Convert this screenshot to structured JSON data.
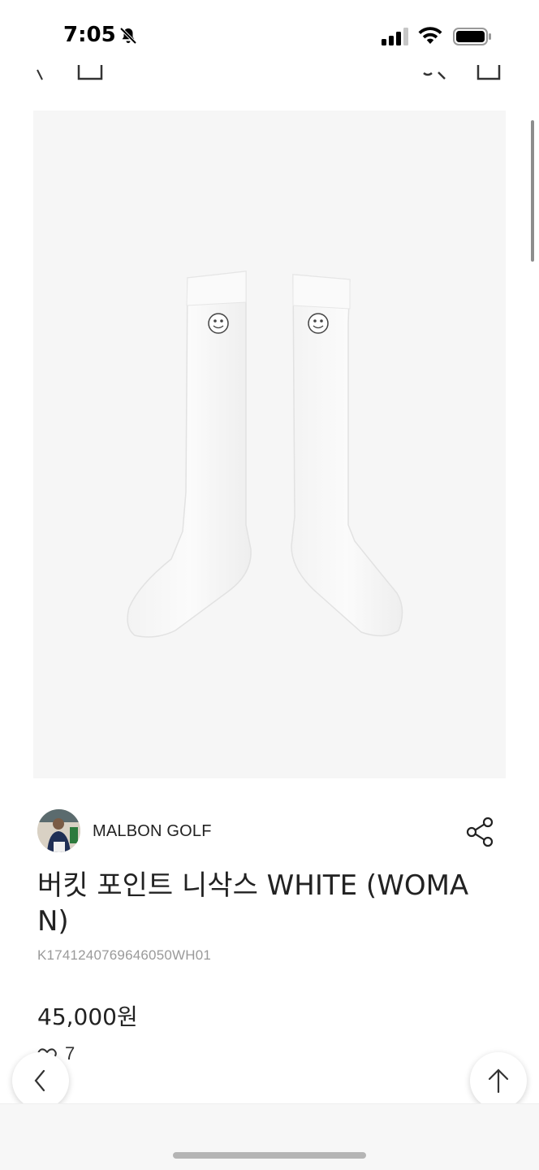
{
  "status_bar": {
    "time": "7:05"
  },
  "product": {
    "brand_name": "MALBON GOLF",
    "title": "버킷 포인트 니삭스 WHITE (WOMAN)",
    "code": "K1741240769646050WH01",
    "price": "45,000원",
    "like_count": "7"
  },
  "icons": {
    "status": [
      "bell-slash-icon",
      "cellular-signal-icon",
      "wifi-icon",
      "battery-icon"
    ],
    "nav": [
      "back-icon",
      "home-icon",
      "search-icon",
      "shopping-bag-icon"
    ],
    "actions": [
      "share-icon",
      "heart-icon",
      "chevron-left-icon",
      "arrow-up-icon"
    ]
  },
  "colors": {
    "background": "#ffffff",
    "image_background": "#f6f6f6",
    "text_primary": "#222222",
    "text_secondary": "#9a9a9a",
    "bottom_bar": "#f7f7f7"
  }
}
